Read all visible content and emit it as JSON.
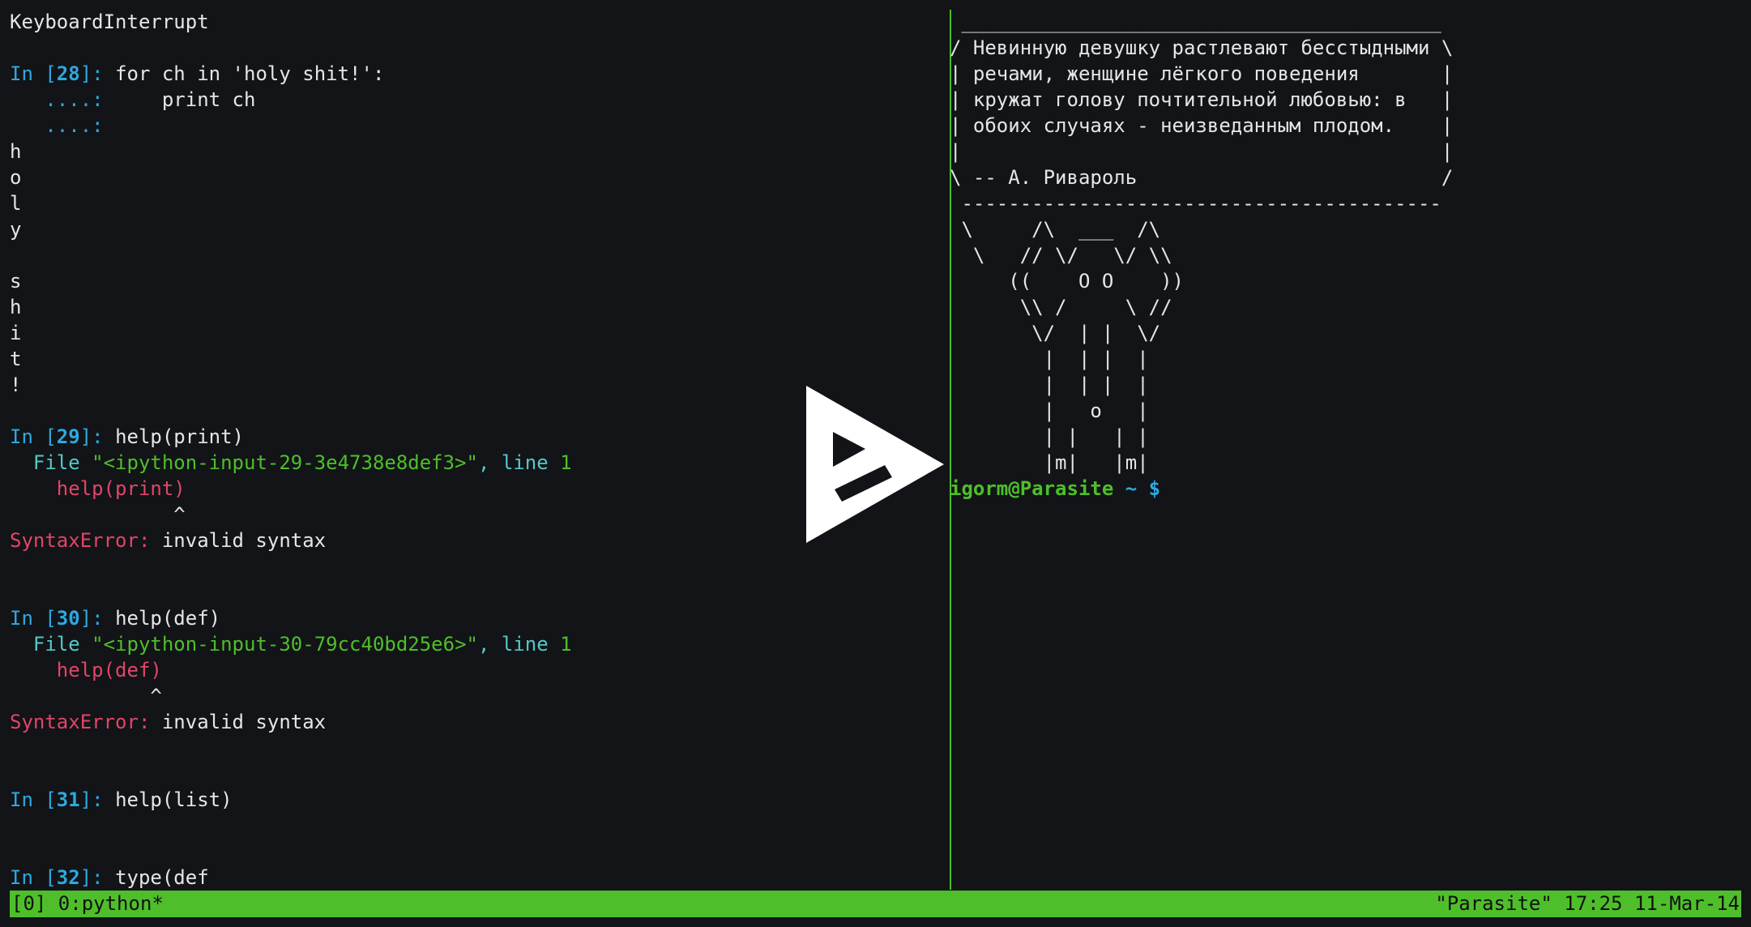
{
  "left_pane": [
    {
      "parts": [
        {
          "t": "KeyboardInterrupt",
          "c": ""
        }
      ]
    },
    {
      "parts": []
    },
    {
      "parts": [
        {
          "t": "In [",
          "c": "blue"
        },
        {
          "t": "28",
          "c": "bblue"
        },
        {
          "t": "]: ",
          "c": "blue"
        },
        {
          "t": "for ch in 'holy shit!':",
          "c": ""
        }
      ]
    },
    {
      "parts": [
        {
          "t": "   ....:",
          "c": "blue"
        },
        {
          "t": "     print ch",
          "c": ""
        }
      ]
    },
    {
      "parts": [
        {
          "t": "   ....:",
          "c": "blue"
        }
      ]
    },
    {
      "parts": [
        {
          "t": "h",
          "c": ""
        }
      ]
    },
    {
      "parts": [
        {
          "t": "o",
          "c": ""
        }
      ]
    },
    {
      "parts": [
        {
          "t": "l",
          "c": ""
        }
      ]
    },
    {
      "parts": [
        {
          "t": "y",
          "c": ""
        }
      ]
    },
    {
      "parts": []
    },
    {
      "parts": [
        {
          "t": "s",
          "c": ""
        }
      ]
    },
    {
      "parts": [
        {
          "t": "h",
          "c": ""
        }
      ]
    },
    {
      "parts": [
        {
          "t": "i",
          "c": ""
        }
      ]
    },
    {
      "parts": [
        {
          "t": "t",
          "c": ""
        }
      ]
    },
    {
      "parts": [
        {
          "t": "!",
          "c": ""
        }
      ]
    },
    {
      "parts": []
    },
    {
      "parts": [
        {
          "t": "In [",
          "c": "blue"
        },
        {
          "t": "29",
          "c": "bblue"
        },
        {
          "t": "]: ",
          "c": "blue"
        },
        {
          "t": "help(print)",
          "c": ""
        }
      ]
    },
    {
      "parts": [
        {
          "t": "  File ",
          "c": "teal"
        },
        {
          "t": "\"<ipython-input-29-3e4738e8def3>\"",
          "c": "green"
        },
        {
          "t": ", line ",
          "c": "teal"
        },
        {
          "t": "1",
          "c": "green"
        }
      ]
    },
    {
      "parts": [
        {
          "t": "    help(print)",
          "c": "red"
        }
      ]
    },
    {
      "parts": [
        {
          "t": "              ^",
          "c": ""
        }
      ]
    },
    {
      "parts": [
        {
          "t": "SyntaxError:",
          "c": "red"
        },
        {
          "t": " invalid syntax",
          "c": ""
        }
      ]
    },
    {
      "parts": []
    },
    {
      "parts": []
    },
    {
      "parts": [
        {
          "t": "In [",
          "c": "blue"
        },
        {
          "t": "30",
          "c": "bblue"
        },
        {
          "t": "]: ",
          "c": "blue"
        },
        {
          "t": "help(def)",
          "c": ""
        }
      ]
    },
    {
      "parts": [
        {
          "t": "  File ",
          "c": "teal"
        },
        {
          "t": "\"<ipython-input-30-79cc40bd25e6>\"",
          "c": "green"
        },
        {
          "t": ", line ",
          "c": "teal"
        },
        {
          "t": "1",
          "c": "green"
        }
      ]
    },
    {
      "parts": [
        {
          "t": "    help(def)",
          "c": "red"
        }
      ]
    },
    {
      "parts": [
        {
          "t": "            ^",
          "c": ""
        }
      ]
    },
    {
      "parts": [
        {
          "t": "SyntaxError:",
          "c": "red"
        },
        {
          "t": " invalid syntax",
          "c": ""
        }
      ]
    },
    {
      "parts": []
    },
    {
      "parts": []
    },
    {
      "parts": [
        {
          "t": "In [",
          "c": "blue"
        },
        {
          "t": "31",
          "c": "bblue"
        },
        {
          "t": "]: ",
          "c": "blue"
        },
        {
          "t": "help(list)",
          "c": ""
        }
      ]
    },
    {
      "parts": []
    },
    {
      "parts": []
    },
    {
      "parts": [
        {
          "t": "In [",
          "c": "blue"
        },
        {
          "t": "32",
          "c": "bblue"
        },
        {
          "t": "]: ",
          "c": "blue"
        },
        {
          "t": "type(def",
          "c": ""
        }
      ]
    }
  ],
  "right_pane": [
    {
      "parts": [
        {
          "t": " _________________________________________",
          "c": ""
        }
      ]
    },
    {
      "parts": [
        {
          "t": "/ Невинную девушку растлевают бесстыдными \\",
          "c": ""
        }
      ]
    },
    {
      "parts": [
        {
          "t": "| речами, женщине лёгкого поведения       |",
          "c": ""
        }
      ]
    },
    {
      "parts": [
        {
          "t": "| кружат голову почтительной любовью: в   |",
          "c": ""
        }
      ]
    },
    {
      "parts": [
        {
          "t": "| обоих случаях - неизведанным плодом.    |",
          "c": ""
        }
      ]
    },
    {
      "parts": [
        {
          "t": "|                                         |",
          "c": ""
        }
      ]
    },
    {
      "parts": [
        {
          "t": "\\ -- А. Ривароль                          /",
          "c": ""
        }
      ]
    },
    {
      "parts": [
        {
          "t": " -----------------------------------------",
          "c": ""
        }
      ]
    },
    {
      "parts": [
        {
          "t": " \\     /\\  ___  /\\",
          "c": ""
        }
      ]
    },
    {
      "parts": [
        {
          "t": "  \\   // \\/   \\/ \\\\",
          "c": ""
        }
      ]
    },
    {
      "parts": [
        {
          "t": "     ((    O O    ))",
          "c": ""
        }
      ]
    },
    {
      "parts": [
        {
          "t": "      \\\\ /     \\ //",
          "c": ""
        }
      ]
    },
    {
      "parts": [
        {
          "t": "       \\/  | |  \\/",
          "c": ""
        }
      ]
    },
    {
      "parts": [
        {
          "t": "        |  | |  |",
          "c": ""
        }
      ]
    },
    {
      "parts": [
        {
          "t": "        |  | |  |",
          "c": ""
        }
      ]
    },
    {
      "parts": [
        {
          "t": "        |   o   |",
          "c": ""
        }
      ]
    },
    {
      "parts": [
        {
          "t": "        | |   | |",
          "c": ""
        }
      ]
    },
    {
      "parts": [
        {
          "t": "        |m|   |m|",
          "c": ""
        }
      ]
    },
    {
      "parts": [
        {
          "t": "igorm@Parasite",
          "c": "bgreen"
        },
        {
          "t": " ~ $",
          "c": "bblue"
        }
      ]
    }
  ],
  "status_bar": {
    "left": "[0] 0:python*",
    "right": "\"Parasite\" 17:25 11-Mar-14"
  },
  "colors": {
    "background": "#121417",
    "status_bar": "#4ebf2a",
    "prompt_blue": "#2ea8e0",
    "error_red": "#e2456a",
    "string_green": "#4ebf2a"
  },
  "overlay_icon": "asciinema-play-icon"
}
